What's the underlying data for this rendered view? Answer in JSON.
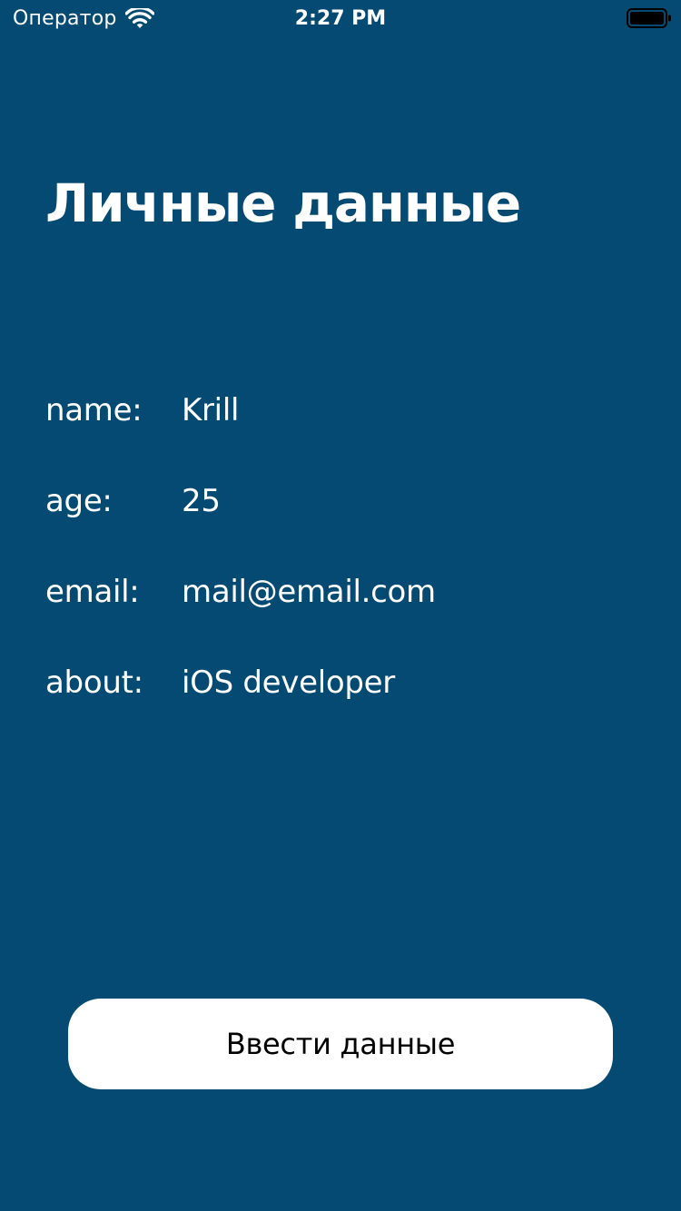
{
  "status_bar": {
    "carrier": "Оператор",
    "time": "2:27 PM",
    "wifi_icon": "wifi-icon",
    "battery_icon": "battery-full-icon"
  },
  "page": {
    "title": "Личные данные",
    "background_color": "#044a72",
    "text_color": "#ffffff"
  },
  "fields": {
    "name": {
      "label": "name:",
      "value": "Krill"
    },
    "age": {
      "label": "age:",
      "value": "25"
    },
    "email": {
      "label": "email:",
      "value": "mail@email.com"
    },
    "about": {
      "label": "about:",
      "value": "iOS developer"
    }
  },
  "enter_button": {
    "label": "Ввести данные",
    "background_color": "#ffffff",
    "text_color": "#000000"
  }
}
